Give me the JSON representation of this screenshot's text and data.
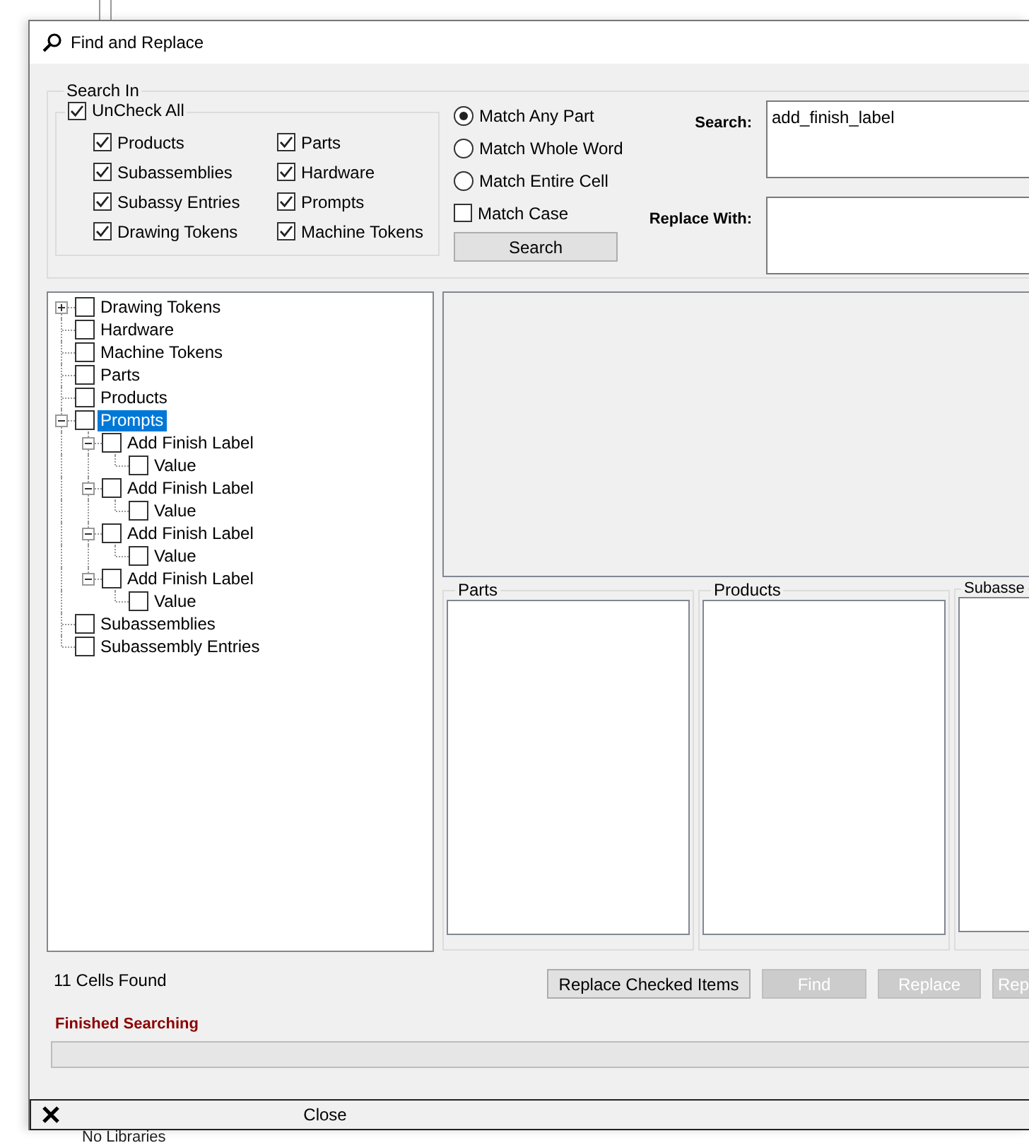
{
  "background": {
    "text": "No Libraries"
  },
  "window": {
    "title": "Find and Replace"
  },
  "search_in": {
    "label": "Search In",
    "uncheck_all": {
      "label": "UnCheck All",
      "checked": true
    },
    "options": [
      {
        "label": "Products",
        "checked": true
      },
      {
        "label": "Parts",
        "checked": true
      },
      {
        "label": "Subassemblies",
        "checked": true
      },
      {
        "label": "Hardware",
        "checked": true
      },
      {
        "label": "Subassy Entries",
        "checked": true
      },
      {
        "label": "Prompts",
        "checked": true
      },
      {
        "label": "Drawing Tokens",
        "checked": true
      },
      {
        "label": "Machine Tokens",
        "checked": true
      }
    ]
  },
  "match_options": [
    {
      "kind": "radio",
      "label": "Match Any Part",
      "selected": true
    },
    {
      "kind": "radio",
      "label": "Match Whole Word",
      "selected": false
    },
    {
      "kind": "radio",
      "label": "Match Entire Cell",
      "selected": false
    },
    {
      "kind": "checkbox",
      "label": "Match Case",
      "checked": false
    }
  ],
  "search_button": "Search",
  "search": {
    "label": "Search:",
    "value": "add_finish_label"
  },
  "replace": {
    "label": "Replace With:"
  },
  "tree": {
    "items": [
      {
        "label": "Drawing Tokens",
        "checked": false,
        "selected": false,
        "expanded": false
      },
      {
        "label": "Hardware",
        "checked": false,
        "selected": false
      },
      {
        "label": "Machine Tokens",
        "checked": false,
        "selected": false
      },
      {
        "label": "Parts",
        "checked": false,
        "selected": false
      },
      {
        "label": "Products",
        "checked": false,
        "selected": false
      },
      {
        "label": "Prompts",
        "checked": false,
        "selected": true,
        "expanded": true,
        "children": [
          {
            "label": "Add Finish Label",
            "checked": false,
            "selected": false,
            "expanded": true,
            "children": [
              {
                "label": "Value",
                "checked": false,
                "selected": false
              }
            ]
          },
          {
            "label": "Add Finish Label",
            "checked": false,
            "selected": false,
            "expanded": true,
            "children": [
              {
                "label": "Value",
                "checked": false,
                "selected": false
              }
            ]
          },
          {
            "label": "Add Finish Label",
            "checked": false,
            "selected": false,
            "expanded": true,
            "children": [
              {
                "label": "Value",
                "checked": false,
                "selected": false
              }
            ]
          },
          {
            "label": "Add Finish Label",
            "checked": false,
            "selected": false,
            "expanded": true,
            "children": [
              {
                "label": "Value",
                "checked": false,
                "selected": false
              }
            ]
          }
        ]
      },
      {
        "label": "Subassemblies",
        "checked": false,
        "selected": false
      },
      {
        "label": "Subassembly Entries",
        "checked": false,
        "selected": false
      }
    ]
  },
  "result_groups": [
    {
      "title": "Parts"
    },
    {
      "title": "Products"
    },
    {
      "title": "Subasse"
    }
  ],
  "status": "11 Cells Found",
  "buttons": [
    {
      "label": "Replace Checked Items",
      "disabled": false
    },
    {
      "label": "Find",
      "disabled": true
    },
    {
      "label": "Replace",
      "disabled": true
    },
    {
      "label": "Rep",
      "disabled": true
    }
  ],
  "message": "Finished Searching",
  "progress": {
    "level": 0
  },
  "close_bar": {
    "label": "Close"
  }
}
